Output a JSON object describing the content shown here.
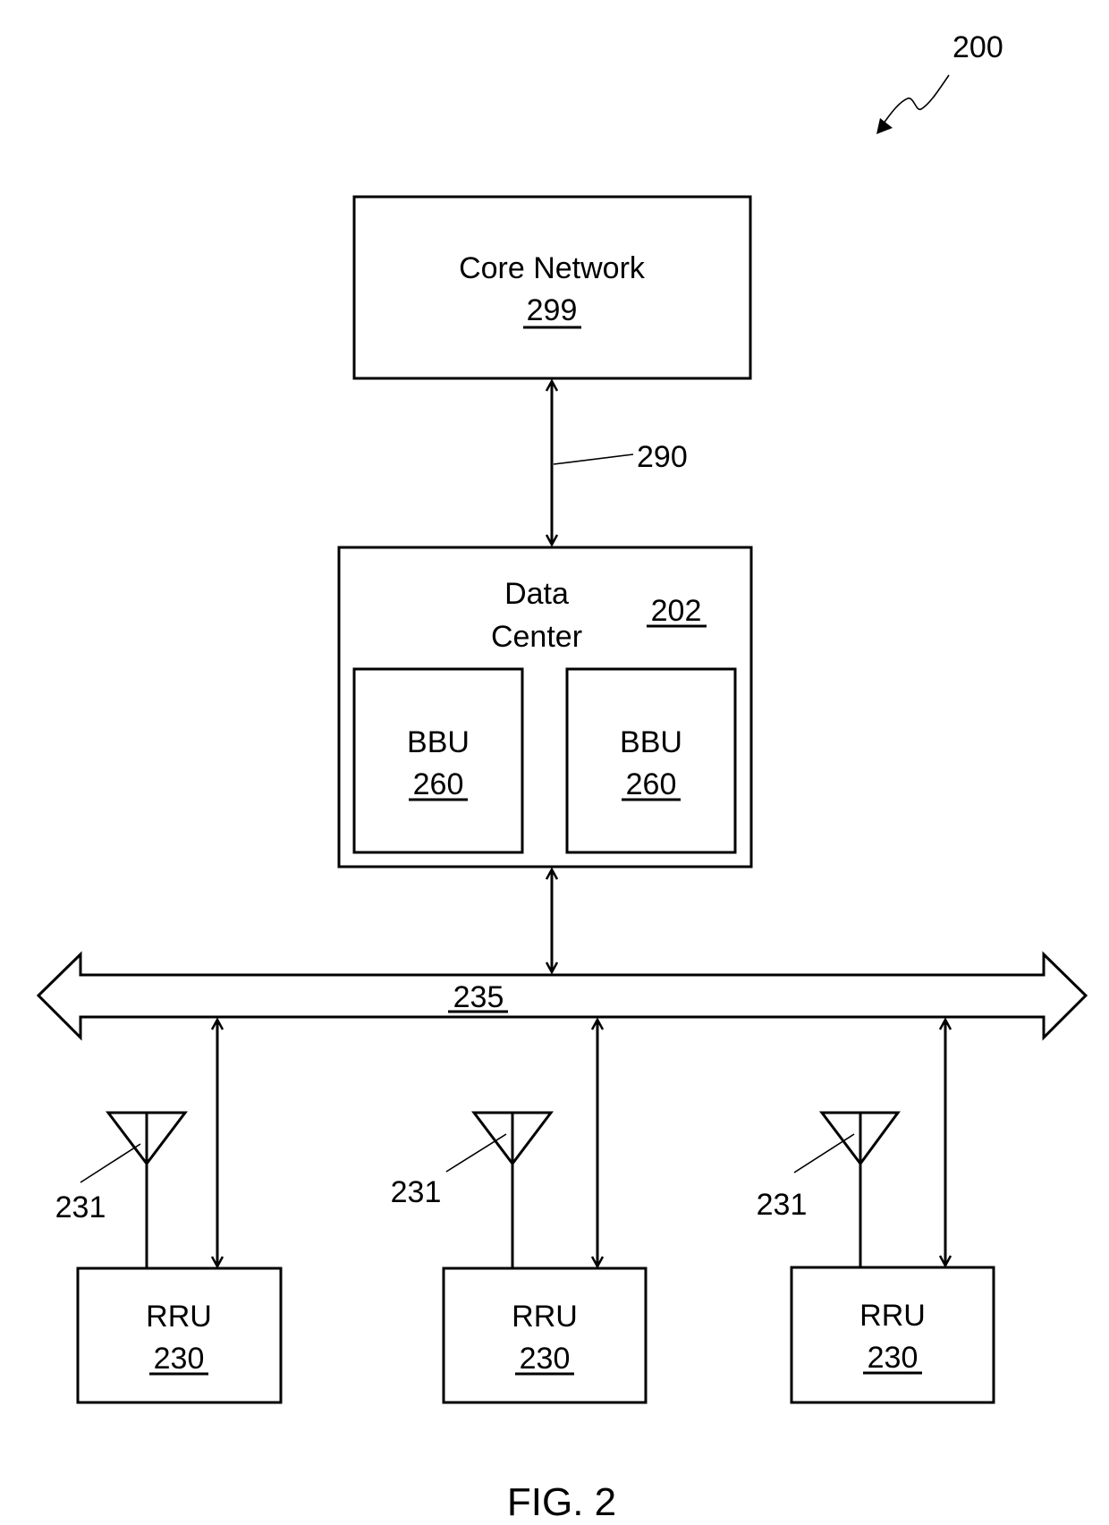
{
  "figure": {
    "reference_label": "200",
    "caption": "FIG. 2"
  },
  "core_network": {
    "title": "Core Network",
    "ref": "299"
  },
  "link_core_to_dc": {
    "ref": "290"
  },
  "data_center": {
    "title_line1": "Data",
    "title_line2": "Center",
    "ref": "202",
    "bbus": [
      {
        "title": "BBU",
        "ref": "260"
      },
      {
        "title": "BBU",
        "ref": "260"
      }
    ]
  },
  "bus": {
    "ref": "235"
  },
  "rrus": [
    {
      "title": "RRU",
      "ref": "230",
      "antenna_ref": "231"
    },
    {
      "title": "RRU",
      "ref": "230",
      "antenna_ref": "231"
    },
    {
      "title": "RRU",
      "ref": "230",
      "antenna_ref": "231"
    }
  ],
  "colors": {
    "stroke": "#000000",
    "background": "#ffffff"
  }
}
